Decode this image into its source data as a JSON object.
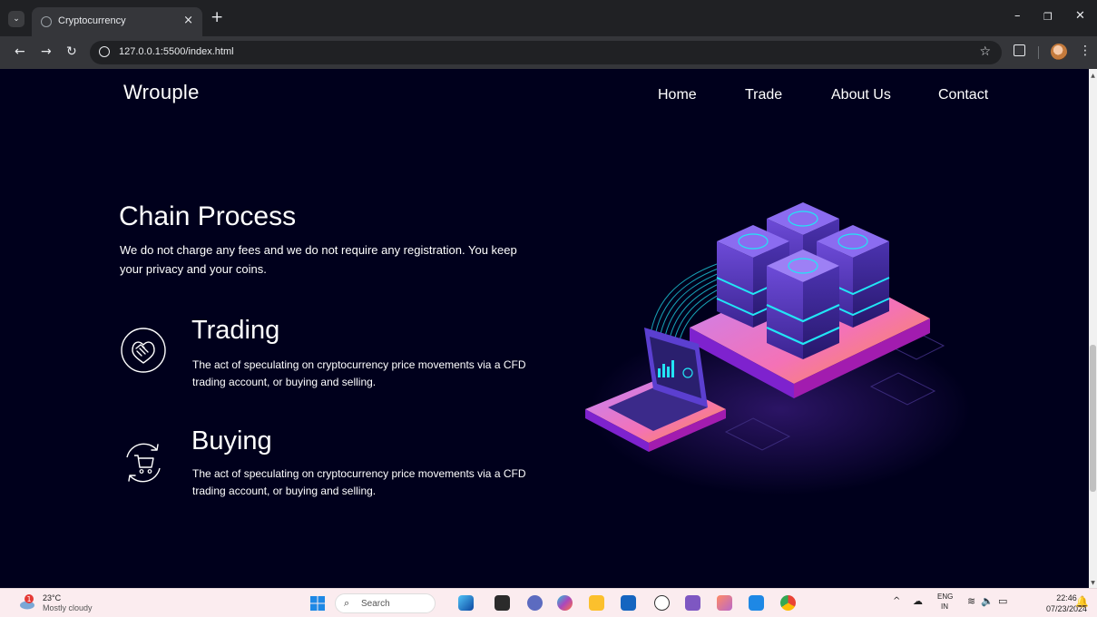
{
  "browser": {
    "tab_title": "Cryptocurrency",
    "tab_close": "×",
    "new_tab": "+",
    "url": "127.0.0.1:5500/index.html",
    "window_controls": {
      "minimize": "–",
      "restore": "❐",
      "close": "✕"
    }
  },
  "site": {
    "logo": "Wrouple",
    "nav": [
      "Home",
      "Trade",
      "About Us",
      "Contact"
    ]
  },
  "hero": {
    "title": "Chain Process",
    "description": "We do not charge any fees and we do not require any registration. You keep your privacy and your coins."
  },
  "features": [
    {
      "title": "Trading",
      "description": "The act of speculating on cryptocurrency price movements via a CFD trading account, or buying and selling.",
      "icon": "handshake-icon"
    },
    {
      "title": "Buying",
      "description": "The act of speculating on cryptocurrency price movements via a CFD trading account, or buying and selling.",
      "icon": "shopping-cart-icon"
    }
  ],
  "taskbar": {
    "weather_temp": "23°C",
    "weather_desc": "Mostly cloudy",
    "weather_alert": "1",
    "search_placeholder": "Search",
    "lang_top": "ENG",
    "lang_bottom": "IN",
    "time": "22:46",
    "date": "07/23/2024"
  },
  "colors": {
    "page_bg": "#00001c",
    "accent_purple": "#8b5cf6",
    "accent_cyan": "#22e5f5",
    "accent_pink": "#f472b6"
  }
}
